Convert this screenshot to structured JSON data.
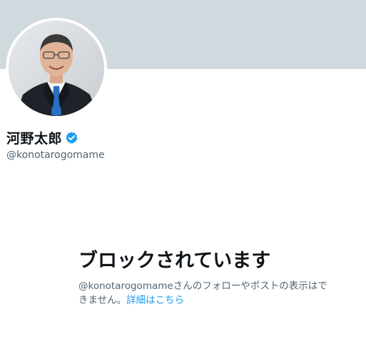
{
  "profile": {
    "display_name": "河野太郎",
    "handle": "@konotarogomame",
    "verified": true,
    "banner_color": "#cfd9de",
    "verified_color": "#1d9bf0"
  },
  "blocked": {
    "title": "ブロックされています",
    "message_line1": "@konotarogomameさんのフォローやポストの表示はで",
    "message_line2": "きません。",
    "link_label": "詳細はこちら",
    "link_color": "#1d9bf0"
  }
}
